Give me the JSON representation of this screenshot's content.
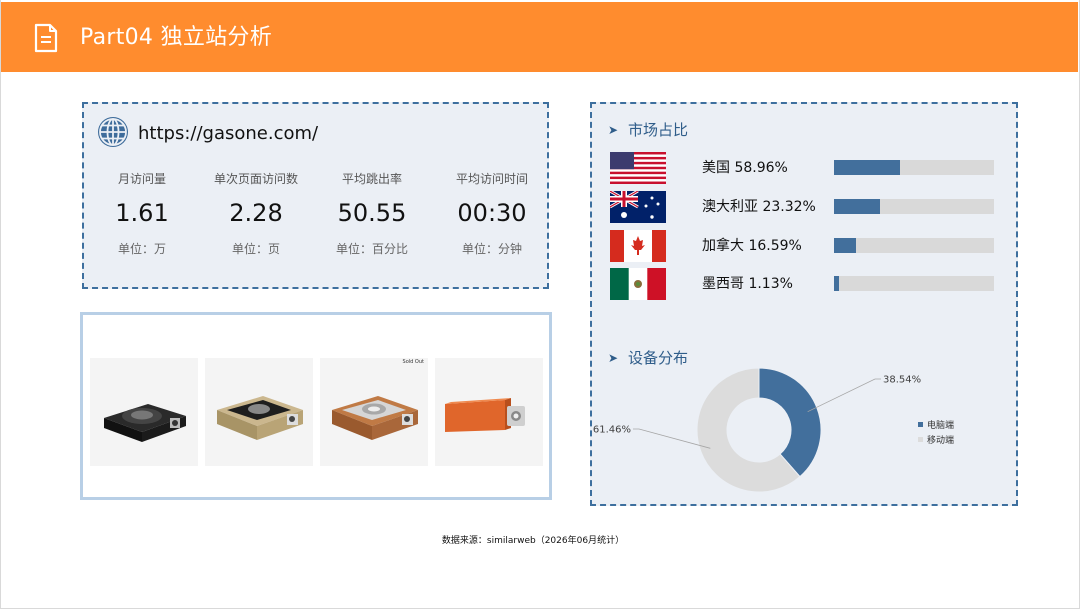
{
  "header": {
    "title": "Part04 独立站分析",
    "icon": "document-icon",
    "color": "#ff8c2e"
  },
  "site": {
    "url": "https://gasone.com/",
    "icon": "globe-icon",
    "stats": [
      {
        "label": "月访问量",
        "value": "1.61",
        "unit": "单位：万"
      },
      {
        "label": "单次页面访问数",
        "value": "2.28",
        "unit": "单位：页"
      },
      {
        "label": "平均跳出率",
        "value": "50.55",
        "unit": "单位：百分比"
      },
      {
        "label": "平均访问时间",
        "value": "00:30",
        "unit": "单位：分钟"
      }
    ]
  },
  "products": {
    "items": [
      "portable-gas-stove-black",
      "portable-gas-stove-gold",
      "portable-gas-stove-copper",
      "gas-canister-case-orange"
    ],
    "sold_out_label": "Sold Out"
  },
  "market": {
    "title": "市场占比",
    "items": [
      {
        "country": "美国",
        "pct_label": "58.96%",
        "share": 0.4101,
        "flag": "us-flag"
      },
      {
        "country": "澳大利亚",
        "pct_label": "23.32%",
        "share": 0.2903,
        "flag": "australia-flag"
      },
      {
        "country": "加拿大",
        "pct_label": "16.59%",
        "share": 0.1402,
        "flag": "canada-flag"
      },
      {
        "country": "墨西哥",
        "pct_label": "1.13%",
        "share": 0.0301,
        "flag": "mexico-flag"
      }
    ],
    "bar_color": "#426f9c",
    "track_color": "#d9d9d9"
  },
  "device": {
    "title": "设备分布",
    "chart_data": {
      "type": "pie",
      "series": [
        {
          "name": "电脑端",
          "value": 38.54,
          "label": "38.54%",
          "color": "#426f9c"
        },
        {
          "name": "移动端",
          "value": 61.46,
          "label": "61.46%",
          "color": "#dcdcdc"
        }
      ],
      "legend_position": "right"
    }
  },
  "footnote": "数据来源：similarweb（2026年06月统计）"
}
